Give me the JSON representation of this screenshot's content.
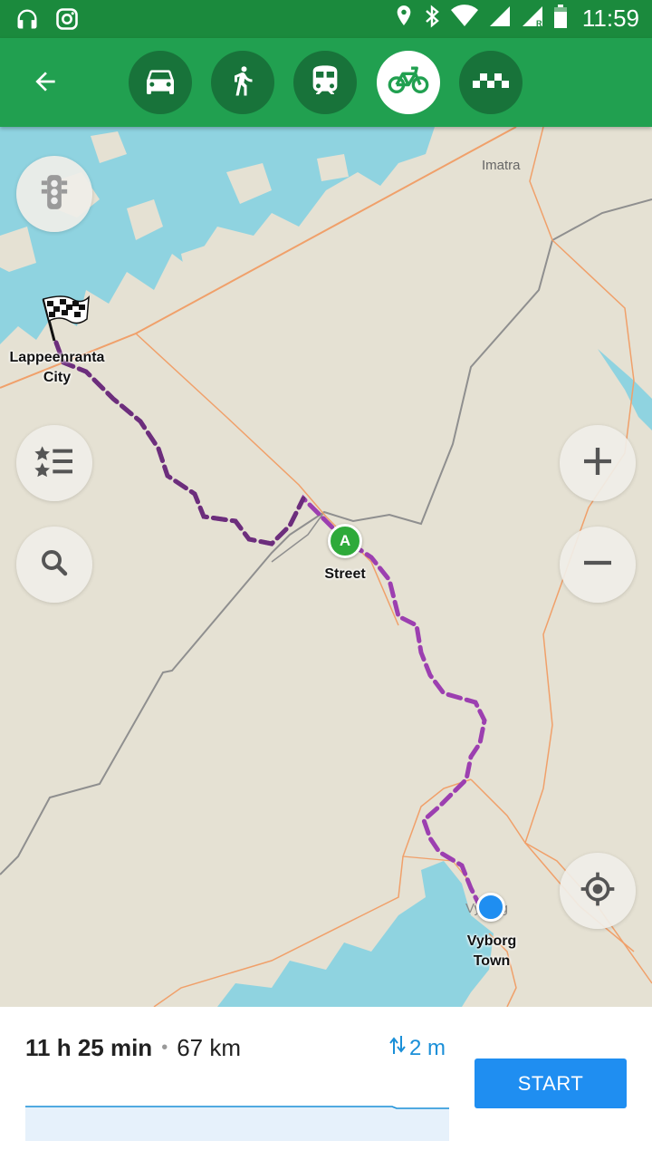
{
  "status_bar": {
    "time": "11:59",
    "left_icons": [
      "headphones-icon",
      "instagram-icon"
    ],
    "right_icons": [
      "location-icon",
      "bluetooth-icon",
      "wifi-icon",
      "signal-icon",
      "signal-roaming-icon",
      "battery-icon"
    ]
  },
  "toolbar": {
    "back_icon": "arrow-left-icon",
    "modes": [
      {
        "name": "car",
        "icon": "car-icon",
        "active": false
      },
      {
        "name": "walk",
        "icon": "pedestrian-icon",
        "active": false
      },
      {
        "name": "transit",
        "icon": "train-icon",
        "active": false
      },
      {
        "name": "bicycle",
        "icon": "bicycle-icon",
        "active": true
      },
      {
        "name": "taxi",
        "icon": "taxi-icon",
        "active": false
      }
    ],
    "accent": "#21a050"
  },
  "map": {
    "labels": {
      "imatra": "Imatra",
      "lappeenranta_line1": "Lappeenranta",
      "lappeenranta_line2": "City",
      "street": "Street",
      "vyborg_line1": "Vyborg",
      "vyborg_line2": "Town",
      "vyborg_small": "Vyborg"
    },
    "marker_a": "A",
    "controls": [
      "traffic-light-icon",
      "bookmarks-icon",
      "search-icon",
      "zoom-in-icon",
      "zoom-out-icon",
      "my-location-icon"
    ]
  },
  "route": {
    "duration": "11 h 25 min",
    "separator": "•",
    "distance": "67 km",
    "elevation": "2 m",
    "start_label": "START",
    "route_color": "#9c3fb0"
  }
}
